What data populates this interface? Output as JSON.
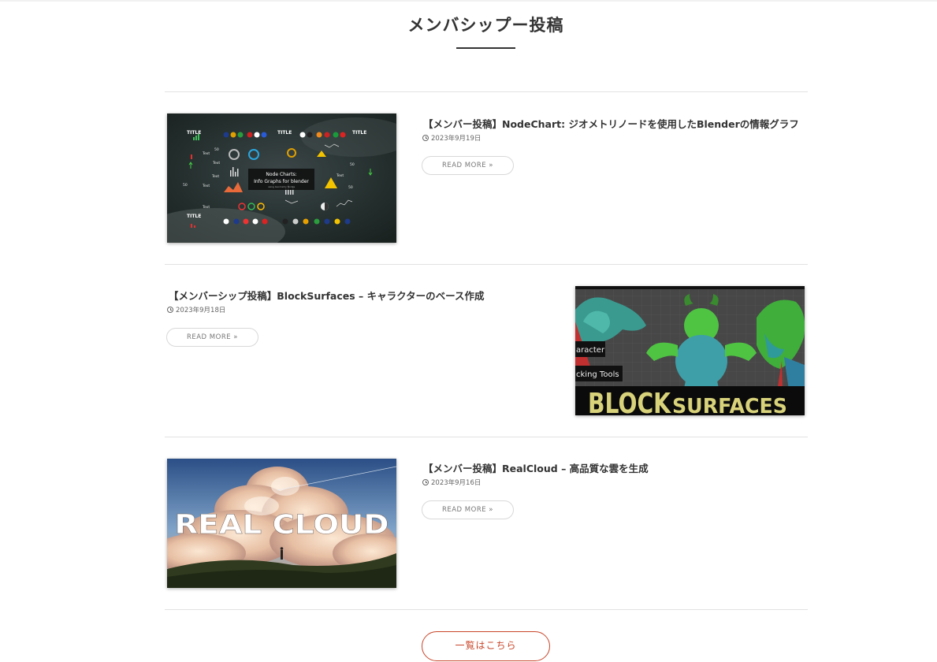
{
  "section": {
    "title": "メンバシップー投稿"
  },
  "posts": [
    {
      "title": "【メンバー投稿】NodeChart: ジオメトリノードを使用したBlenderの情報グラフ",
      "date": "2023年9月19日",
      "read_more": "READ MORE »",
      "thumb_text": {
        "t1": "TITLE",
        "t2": "TITLE",
        "t3": "TITLE",
        "t4": "TITLE",
        "center1": "Node Charts:",
        "center2": "Info Graphs for blender",
        "center3": "using Geometry Nodes",
        "text1": "Text",
        "text2": "Text",
        "text3": "Text",
        "text4": "Text",
        "text5": "Text",
        "text6": "Text",
        "n1": "50",
        "n2": "50",
        "n3": "50",
        "n4": "50"
      }
    },
    {
      "title": "【メンバーシップ投稿】BlockSurfaces – キャラクターのベース作成",
      "date": "2023年9月18日",
      "read_more": "READ MORE »",
      "thumb_text": {
        "tag1": "aracter",
        "tag2": "cking Tools",
        "logo_a": "BLOCK",
        "logo_b": "SURFACES"
      }
    },
    {
      "title": "【メンバー投稿】RealCloud – 高品質な雲を生成",
      "date": "2023年9月16日",
      "read_more": "READ MORE »",
      "thumb_text": {
        "logo": "REAL CLOUD"
      }
    }
  ],
  "list_button": {
    "label": "一覧はこちら"
  },
  "colors": {
    "accent": "#c8462a",
    "text": "#333333",
    "divider": "#e2e2e2"
  }
}
